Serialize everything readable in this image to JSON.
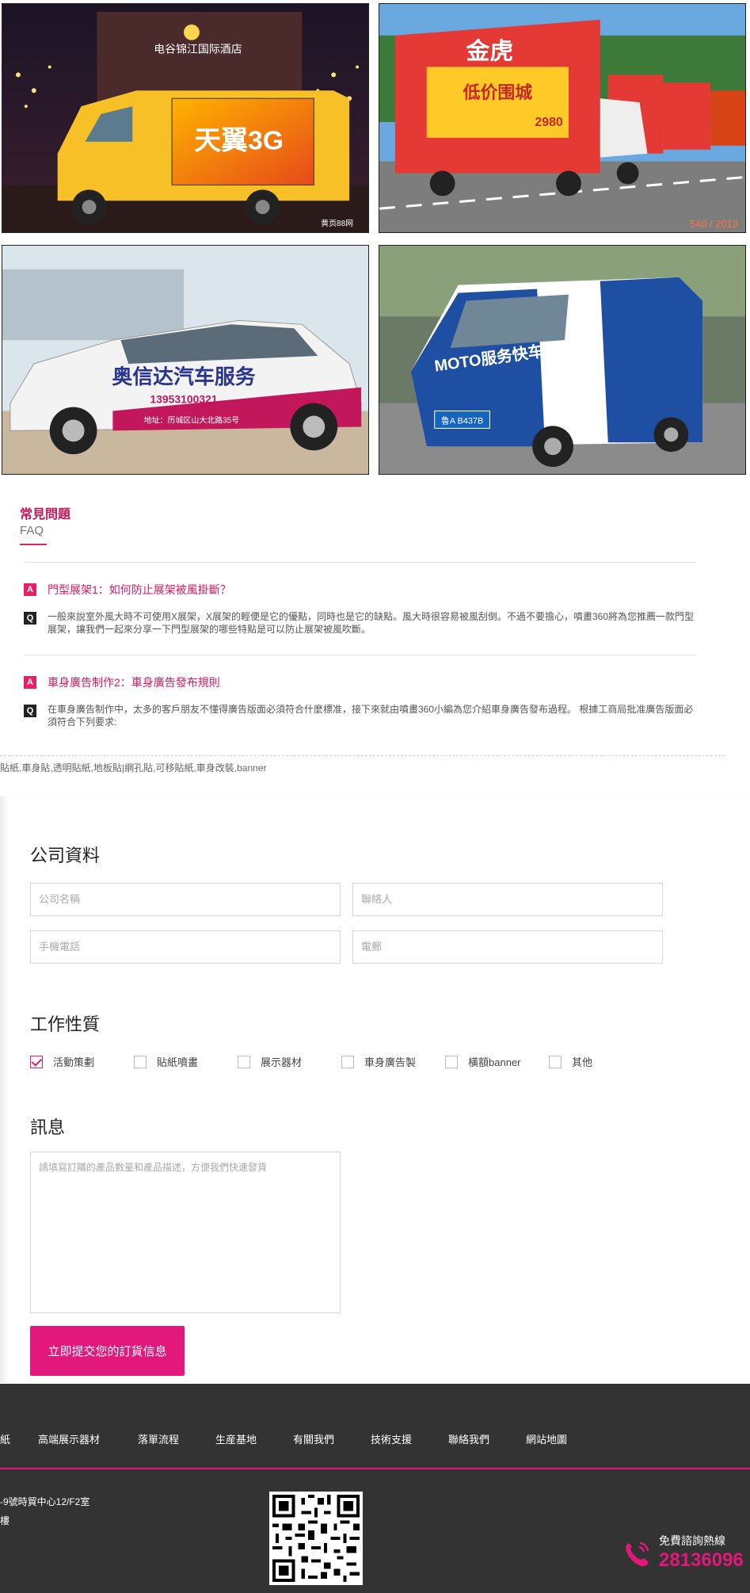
{
  "gallery": {
    "photos": [
      {
        "alt": "電谷錦江國際酒店前的天翼3G廣告車",
        "sign": "电谷锦江国际酒店",
        "ad_text": "天翼3G",
        "watermark": "黄页88网"
      },
      {
        "alt": "金虎家私低价围城廣告車隊",
        "ad_text": "金虎",
        "promo": "低价围城",
        "price": "2980",
        "stamp": "540 / 2013"
      },
      {
        "alt": "奥信达汽车服务車身廣告",
        "brand": "奥信达汽车服务",
        "phone": "13953100321",
        "addr": "地址：历城区山大北路35号"
      },
      {
        "alt": "MOTO服务快车車身廣告",
        "brand": "MOTO服务快车",
        "plate": "鲁A B437B"
      }
    ]
  },
  "faq": {
    "title": "常見問題",
    "subtitle": "FAQ",
    "items": [
      {
        "badge_q": "A",
        "question": "門型展架1：如何防止展架被風掛斷？",
        "badge_a": "Q",
        "answer": "一般來說室外風大時不可使用X展架，X展架的輕便是它的優點，同時也是它的缺點。風大時很容易被風刮倒。不過不要擔心，噴畫360將為您推薦一款門型展架，讓我們一起來分享一下門型展架的哪些特點是可以防止展架被風吹斷。"
      },
      {
        "badge_q": "A",
        "question": "車身廣告制作2：車身廣告發布規則",
        "badge_a": "Q",
        "answer": "在車身廣告制作中，太多的客戶朋友不懂得廣告版面必須符合什麼標准，接下來就由噴畫360小編為您介紹車身廣告發布過程。 根據工商局批准廣告版面必須符合下列要求:"
      }
    ]
  },
  "tags": "貼紙,車身貼,透明貼紙,地板貼|網孔貼,可移貼紙,車身改裝,banner",
  "form": {
    "company_title": "公司資料",
    "company_name_ph": "公司名稱",
    "contact_ph": "聯絡人",
    "mobile_ph": "手機電話",
    "email_ph": "電郵",
    "work_title": "工作性質",
    "options": [
      {
        "label": "活動策劃",
        "checked": true
      },
      {
        "label": "貼紙噴畫",
        "checked": false
      },
      {
        "label": "展示器材",
        "checked": false
      },
      {
        "label": "車身廣告製",
        "checked": false
      },
      {
        "label": "橫額banner",
        "checked": false
      },
      {
        "label": "其他",
        "checked": false
      }
    ],
    "message_title": "訊息",
    "message_ph": "請填寫訂購的產品數量和產品描述，方便我們快速發貨",
    "submit": "立即提交您的訂貨信息"
  },
  "footer": {
    "nav": [
      "紙",
      "高端展示器材",
      "落單流程",
      "生産基地",
      "有關我們",
      "技術支援",
      "聯絡我們",
      "網站地圖"
    ],
    "address": "-9號時貿中心12/F2室",
    "address2": "樓",
    "hotline_label": "免費諮詢熱線",
    "hotline_number": "28136096"
  },
  "colors": {
    "accent": "#e2187a",
    "footer_bg": "#333333"
  }
}
